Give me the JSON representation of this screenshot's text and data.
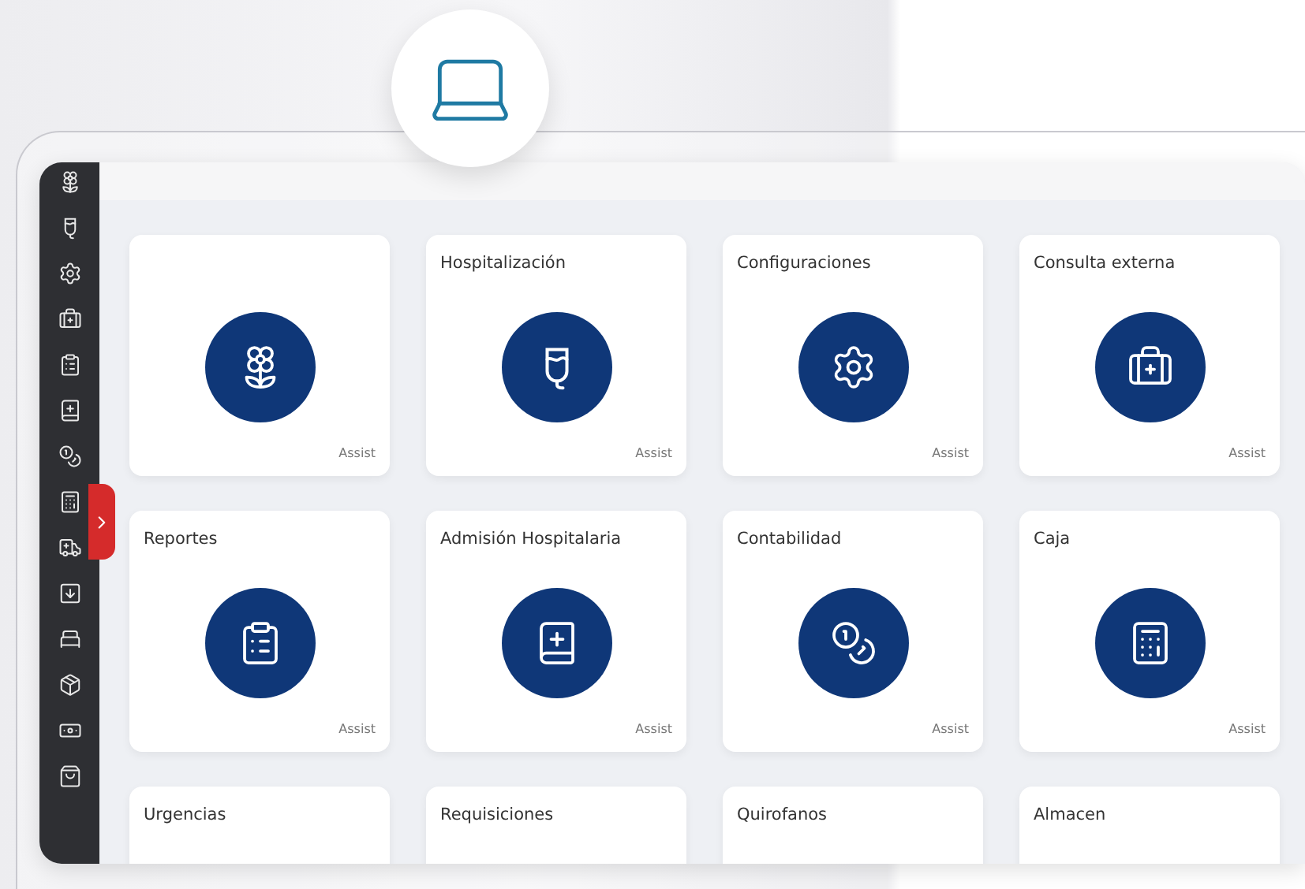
{
  "cards": [
    {
      "footer": "Assist"
    },
    {
      "title": "Hospitalización",
      "footer": "Assist"
    },
    {
      "title": "Configuraciones",
      "footer": "Assist"
    },
    {
      "title": "Consulta externa",
      "footer": "Assist"
    },
    {
      "title": "Reportes",
      "footer": "Assist"
    },
    {
      "title": "Admisión Hospitalaria",
      "footer": "Assist"
    },
    {
      "title": "Contabilidad",
      "footer": "Assist"
    },
    {
      "title": "Caja",
      "footer": "Assist"
    },
    {
      "title": "Urgencias"
    },
    {
      "title": "Requisiciones"
    },
    {
      "title": "Quirofanos"
    },
    {
      "title": "Almacen"
    }
  ],
  "sidebar": {
    "expanded": false
  }
}
